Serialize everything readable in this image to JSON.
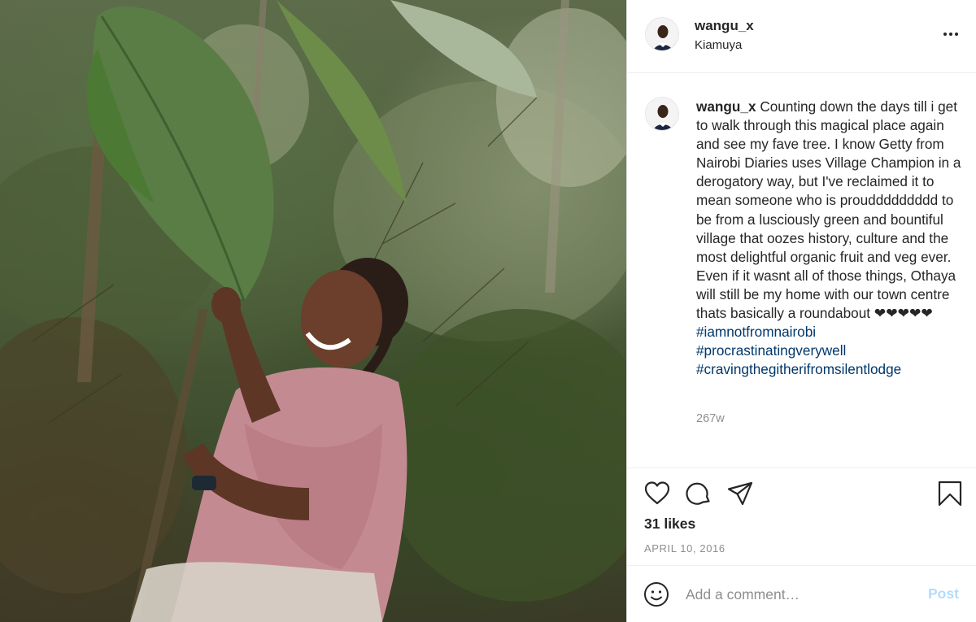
{
  "post": {
    "image_alt": "Woman in pink shawl smiling beside a large leaf in a green forest"
  },
  "header": {
    "username": "wangu_x",
    "location": "Kiamuya"
  },
  "caption": {
    "username": "wangu_x",
    "text": "Counting down the days till i get to walk through this magical place again and see my fave tree. I know Getty from Nairobi Diaries uses Village Champion in a derogatory way, but I've reclaimed it to mean someone who is prouddddddddd to be from a lusciously green and bountiful village that oozes history, culture and the most delightful organic fruit and veg ever. Even if it wasnt all of those things, Othaya will still be my home with our town centre thats basically a roundabout ❤❤❤❤❤",
    "hashtags": [
      "#iamnotfromnairobi",
      "#procrastinatingverywell",
      "#cravingthegitherifromsilentlodge"
    ],
    "time_ago": "267w"
  },
  "actions": {
    "likes": "31 likes",
    "date": "APRIL 10, 2016",
    "icons": [
      "heart-icon",
      "comment-icon",
      "share-icon",
      "bookmark-icon"
    ]
  },
  "comment": {
    "placeholder": "Add a comment…",
    "post_label": "Post"
  },
  "colors": {
    "text": "#262626",
    "secondary": "#8e8e8e",
    "hashtag": "#00376b",
    "post_disabled": "#b3dbff",
    "divider": "#efefef"
  }
}
